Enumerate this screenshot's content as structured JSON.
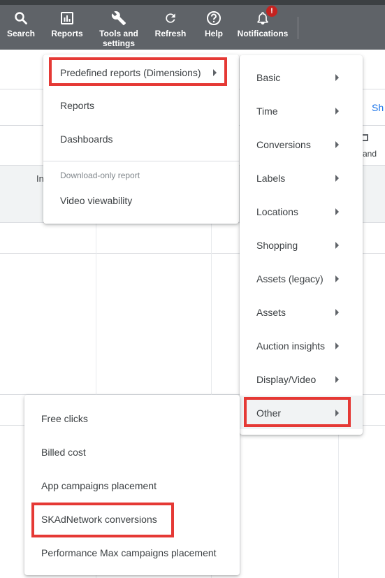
{
  "toolbar": {
    "search": {
      "label": "Search",
      "icon": "search-icon"
    },
    "reports": {
      "label": "Reports",
      "icon": "reports-icon"
    },
    "tools": {
      "label": "Tools and\nsettings",
      "icon": "wrench-icon"
    },
    "refresh": {
      "label": "Refresh",
      "icon": "refresh-icon"
    },
    "help": {
      "label": "Help",
      "icon": "help-icon"
    },
    "notifications": {
      "label": "Notifications",
      "icon": "bell-icon",
      "badge": "!"
    }
  },
  "background": {
    "show_link": "Sh",
    "partial_col_header": "In",
    "partial_expand_label": "and"
  },
  "reports_menu": {
    "predefined": "Predefined reports (Dimensions)",
    "reports": "Reports",
    "dashboards": "Dashboards",
    "section_label": "Download-only report",
    "video_viewability": "Video viewability"
  },
  "dimensions_menu": {
    "items": [
      "Basic",
      "Time",
      "Conversions",
      "Labels",
      "Locations",
      "Shopping",
      "Assets (legacy)",
      "Assets",
      "Auction insights",
      "Display/Video",
      "Other"
    ]
  },
  "other_menu": {
    "items": [
      "Free clicks",
      "Billed cost",
      "App campaigns placement",
      "SKAdNetwork conversions",
      "Performance Max campaigns placement"
    ]
  },
  "colors": {
    "toolbar": "#5f6368",
    "highlight": "#e53935",
    "link": "#1a73e8",
    "badge": "#c5221f"
  }
}
